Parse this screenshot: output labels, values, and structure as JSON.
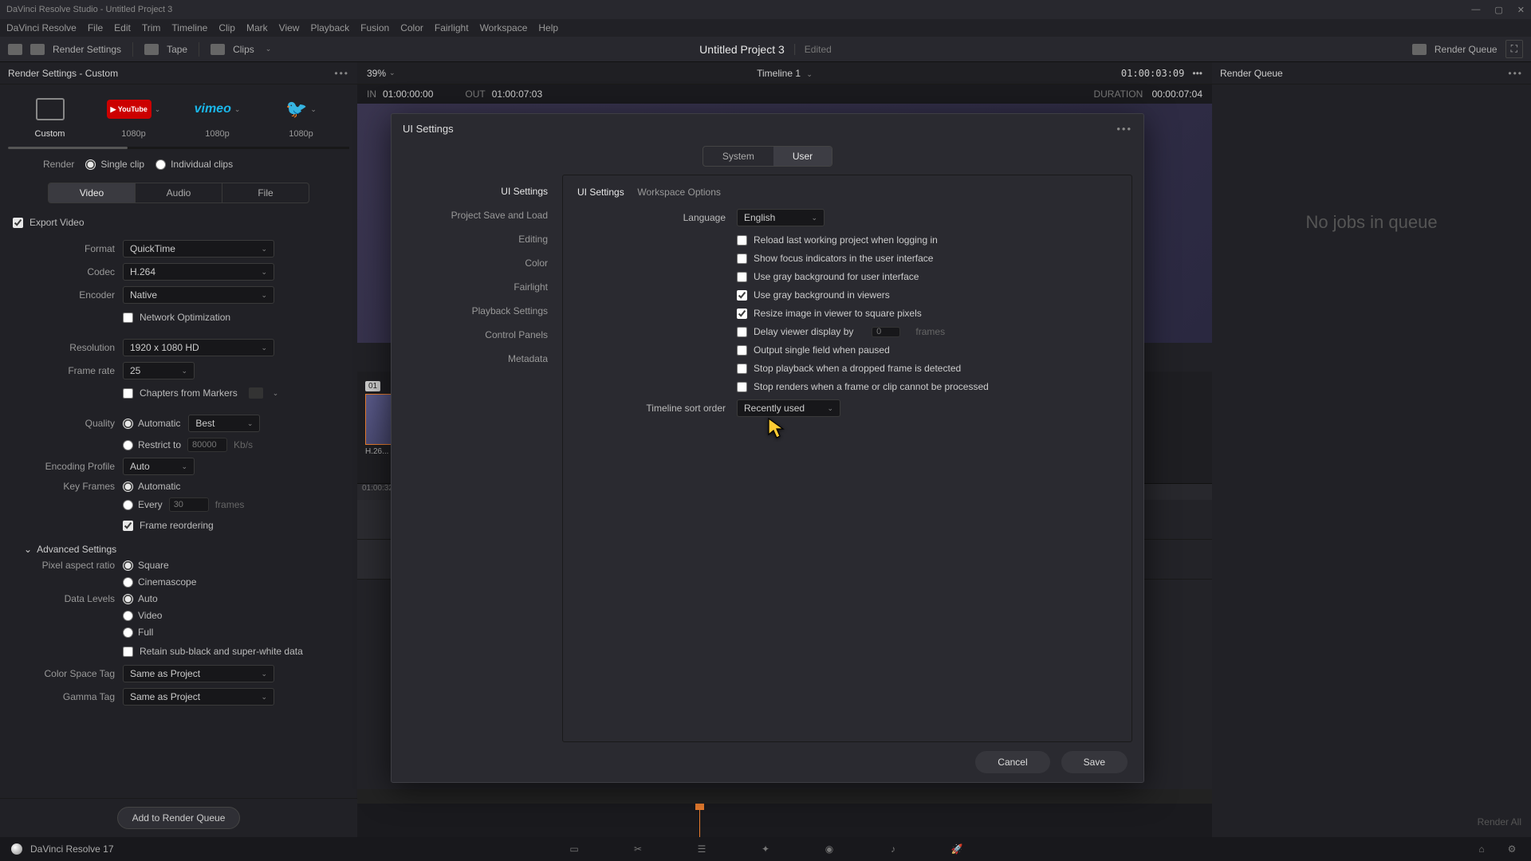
{
  "titlebar": {
    "text": "DaVinci Resolve Studio - Untitled Project 3"
  },
  "menubar": [
    "DaVinci Resolve",
    "File",
    "Edit",
    "Trim",
    "Timeline",
    "Clip",
    "Mark",
    "View",
    "Playback",
    "Fusion",
    "Color",
    "Fairlight",
    "Workspace",
    "Help"
  ],
  "toolbar": {
    "render_settings": "Render Settings",
    "tape": "Tape",
    "clips": "Clips",
    "project": "Untitled Project 3",
    "edited": "Edited",
    "render_queue": "Render Queue"
  },
  "left": {
    "title": "Render Settings - Custom",
    "presets": [
      {
        "name": "Custom",
        "sub": ""
      },
      {
        "name": "YouTube",
        "sub": "1080p"
      },
      {
        "name": "Vimeo",
        "sub": "1080p"
      },
      {
        "name": "Twitter",
        "sub": "1080p"
      }
    ],
    "render_label": "Render",
    "render_single": "Single clip",
    "render_individual": "Individual clips",
    "tabs": {
      "video": "Video",
      "audio": "Audio",
      "file": "File"
    },
    "export_video": "Export Video",
    "format_label": "Format",
    "format_value": "QuickTime",
    "codec_label": "Codec",
    "codec_value": "H.264",
    "encoder_label": "Encoder",
    "encoder_value": "Native",
    "network_opt": "Network Optimization",
    "resolution_label": "Resolution",
    "resolution_value": "1920 x 1080 HD",
    "framerate_label": "Frame rate",
    "framerate_value": "25",
    "chapters": "Chapters from Markers",
    "quality_label": "Quality",
    "quality_auto": "Automatic",
    "quality_best": "Best",
    "restrict": "Restrict to",
    "restrict_value": "80000",
    "kbps": "Kb/s",
    "enc_profile_label": "Encoding Profile",
    "enc_profile_value": "Auto",
    "keyframes_label": "Key Frames",
    "keyframes_auto": "Automatic",
    "keyframes_every": "Every",
    "keyframes_every_val": "30",
    "frames": "frames",
    "frame_reorder": "Frame reordering",
    "advanced": "Advanced Settings",
    "par_label": "Pixel aspect ratio",
    "par_square": "Square",
    "par_cine": "Cinemascope",
    "data_levels_label": "Data Levels",
    "dl_auto": "Auto",
    "dl_video": "Video",
    "dl_full": "Full",
    "retain_sub": "Retain sub-black and super-white data",
    "cst_label": "Color Space Tag",
    "cst_value": "Same as Project",
    "gamma_label": "Gamma Tag",
    "gamma_value": "Same as Project",
    "add_queue": "Add to Render Queue"
  },
  "viewer": {
    "zoom": "39%",
    "timeline": "Timeline 1",
    "tc": "01:00:03:09",
    "in_label": "IN",
    "in_tc": "01:00:00:00",
    "out_label": "OUT",
    "out_tc": "01:00:07:03",
    "dur_label": "DURATION",
    "dur_tc": "00:00:07:04",
    "thumb_num": "01",
    "thumb_label": "H.26...",
    "render_all": "Render All"
  },
  "queue": {
    "title": "Render Queue",
    "empty": "No jobs in queue"
  },
  "modal": {
    "title": "UI Settings",
    "tab_system": "System",
    "tab_user": "User",
    "nav": [
      "UI Settings",
      "Project Save and Load",
      "Editing",
      "Color",
      "Fairlight",
      "Playback Settings",
      "Control Panels",
      "Metadata"
    ],
    "sub_ui": "UI Settings",
    "sub_workspace": "Workspace Options",
    "language_label": "Language",
    "language_value": "English",
    "reload": "Reload last working project when logging in",
    "focus_ind": "Show focus indicators in the user interface",
    "gray_ui": "Use gray background for user interface",
    "gray_viewers": "Use gray background in viewers",
    "resize_square": "Resize image in viewer to square pixels",
    "delay_label": "Delay viewer display by",
    "delay_val": "0",
    "delay_frames": "frames",
    "output_single": "Output single field when paused",
    "stop_dropped": "Stop playback when a dropped frame is detected",
    "stop_render": "Stop renders when a frame or clip cannot be processed",
    "sort_label": "Timeline sort order",
    "sort_value": "Recently used",
    "cancel": "Cancel",
    "save": "Save"
  },
  "bottombar": {
    "version": "DaVinci Resolve 17"
  }
}
